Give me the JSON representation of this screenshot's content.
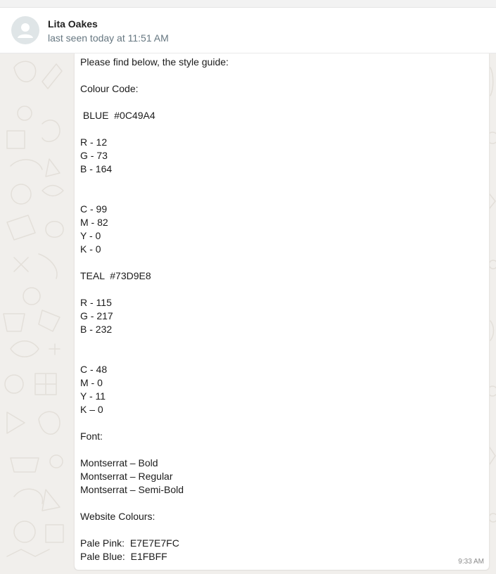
{
  "contact": {
    "name": "Lita Oakes",
    "status": "last seen today at 11:51 AM"
  },
  "message": {
    "lines": [
      "Please find below, the style guide:",
      "",
      "Colour Code:",
      "",
      " BLUE  #0C49A4",
      "",
      "R - 12",
      "G - 73",
      "B - 164",
      "",
      "",
      "C - 99",
      "M - 82",
      "Y - 0",
      "K - 0",
      "",
      "TEAL  #73D9E8",
      "",
      "R - 115",
      "G - 217",
      "B - 232",
      "",
      "",
      "C - 48",
      "M - 0",
      "Y - 11",
      "K – 0",
      "",
      "Font:",
      "",
      "Montserrat – Bold",
      "Montserrat – Regular",
      "Montserrat – Semi-Bold",
      "",
      "Website Colours:",
      "",
      "Pale Pink:  E7E7E7FC",
      "Pale Blue:  E1FBFF"
    ],
    "time": "9:33 AM"
  },
  "colors": {
    "chat_background": "#f1efec",
    "bubble": "#ffffff",
    "status_text": "#667781"
  },
  "icons": {
    "avatar": "default-avatar-icon",
    "wallpaper": "doodle-pattern"
  }
}
